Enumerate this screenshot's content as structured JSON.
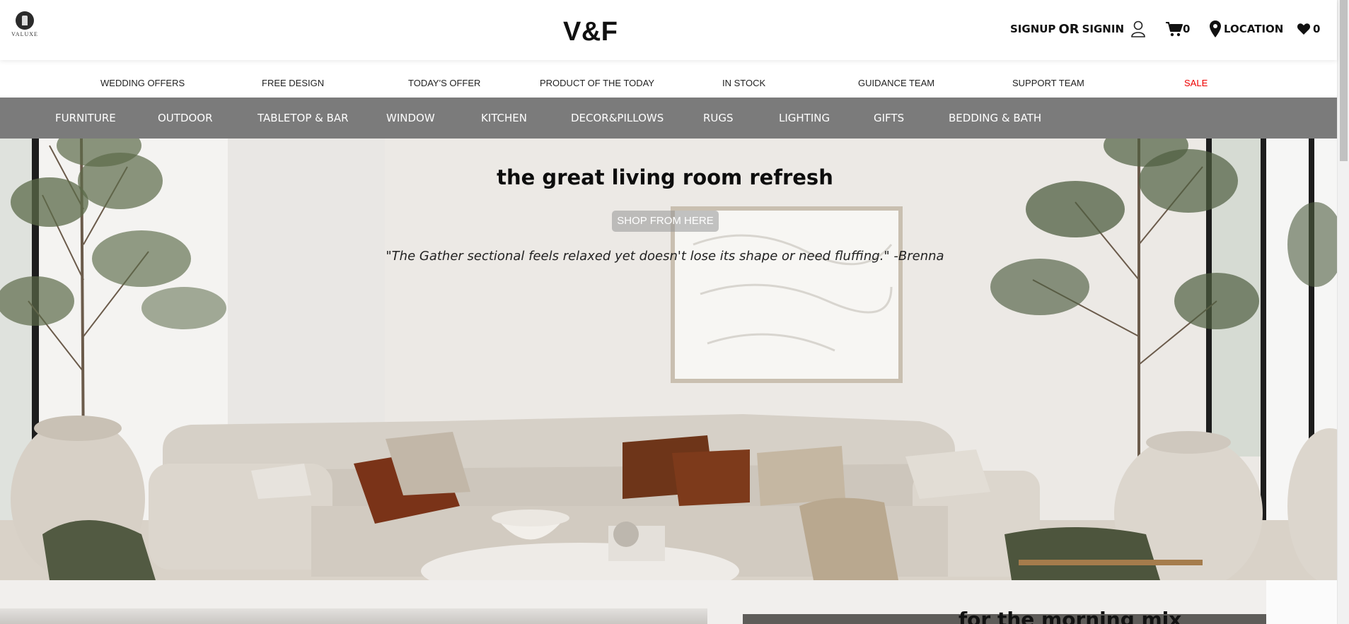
{
  "header": {
    "logo_text": "VALUXE",
    "brand": "V&F",
    "signup": "SIGNUP",
    "or": "OR",
    "signin": "SIGNIN",
    "cart_count": "0",
    "location": "LOCATION",
    "wishlist_count": "0"
  },
  "subnav": [
    "WEDDING OFFERS",
    "FREE DESIGN",
    "TODAY'S OFFER",
    "PRODUCT OF THE TODAY",
    "IN STOCK",
    "GUIDANCE TEAM",
    "SUPPORT TEAM",
    "SALE"
  ],
  "categories": [
    "FURNITURE",
    "OUTDOOR",
    "TABLETOP & BAR",
    "WINDOW",
    "KITCHEN",
    "DECOR&PILLOWS",
    "RUGS",
    "LIGHTING",
    "GIFTS",
    "BEDDING & BATH"
  ],
  "hero": {
    "title": "the great living room refresh",
    "button": "SHOP FROM HERE",
    "quote": "\"The Gather sectional feels relaxed yet doesn't lose its shape or need fluffing.\" -Brenna"
  },
  "next_section": {
    "title": "for the morning mix"
  },
  "colors": {
    "category_bar": "#7b7b7b",
    "sale": "#e00000",
    "hero_wall": "#ece9e5"
  }
}
